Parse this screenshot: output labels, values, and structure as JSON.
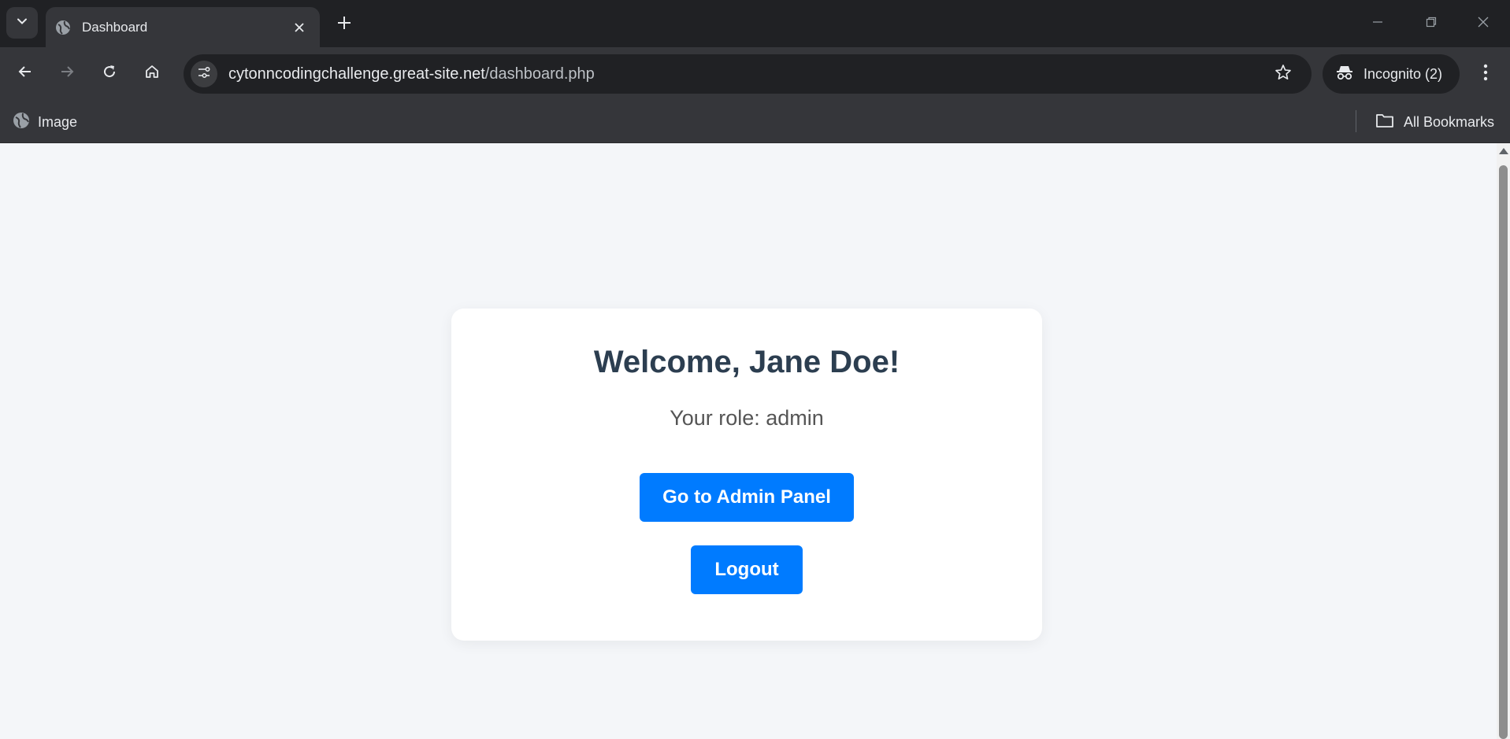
{
  "browser": {
    "tab_title": "Dashboard",
    "url_host": "cytonncodingchallenge.great-site.net",
    "url_path": "/dashboard.php",
    "incognito_label": "Incognito (2)",
    "bookmarks": [
      {
        "label": "Image"
      }
    ],
    "all_bookmarks_label": "All Bookmarks"
  },
  "page": {
    "welcome": "Welcome, Jane Doe!",
    "role_text": "Your role: admin",
    "admin_button": "Go to Admin Panel",
    "logout_button": "Logout"
  },
  "colors": {
    "primary_button": "#007bff",
    "heading": "#2c3e50",
    "page_background": "#f4f6f9"
  }
}
